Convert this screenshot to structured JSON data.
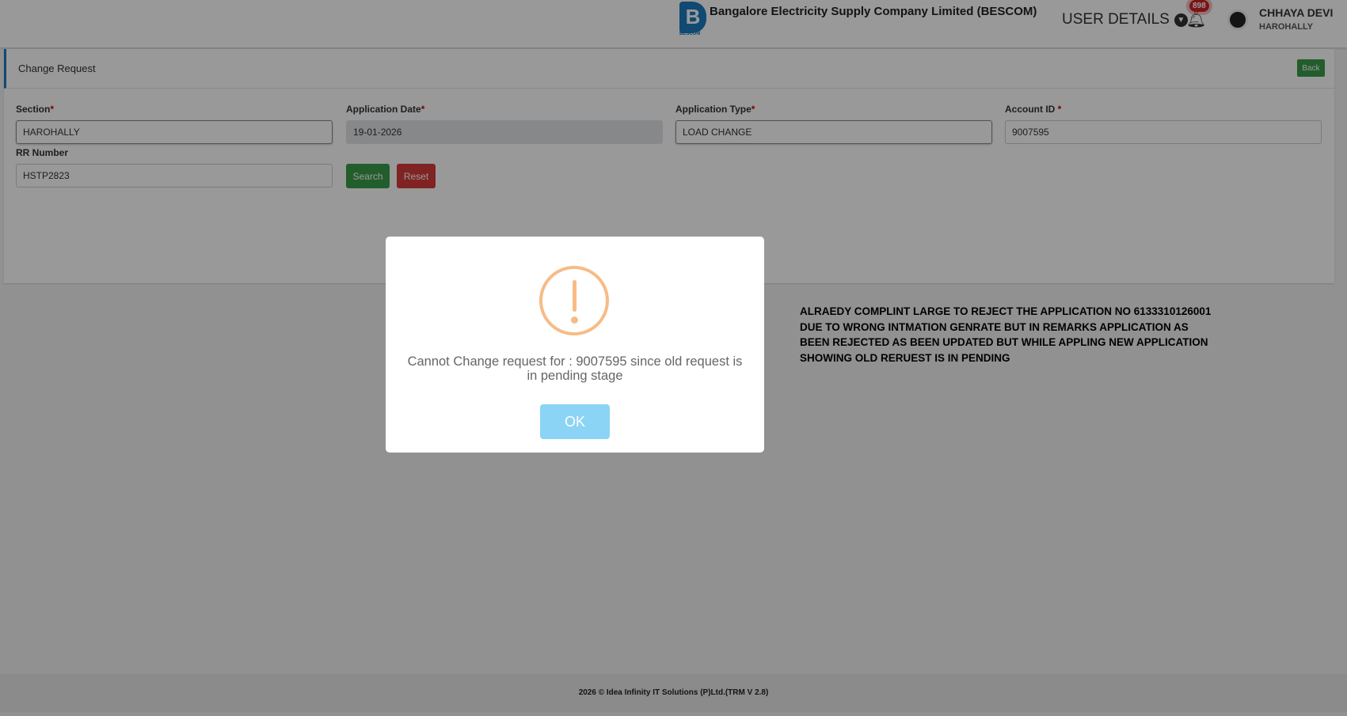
{
  "header": {
    "logo_text": "B",
    "logo_sub": "BESCOM",
    "company": "Bangalore Electricity Supply Company Limited (BESCOM)",
    "user_details": "USER DETAILS",
    "notifications": "898",
    "user_name": "CHHAYA DEVI",
    "user_location": "HAROHALLY"
  },
  "card": {
    "title": "Change Request",
    "back": "Back"
  },
  "form": {
    "section": {
      "label": "Section",
      "value": "HAROHALLY"
    },
    "app_date": {
      "label": "Application Date",
      "value": "19-01-2026"
    },
    "app_type": {
      "label": "Application Type",
      "value": "LOAD CHANGE"
    },
    "account": {
      "label": "Account ID ",
      "value": "9007595"
    },
    "rr": {
      "label": "RR Number",
      "value": "HSTP2823"
    },
    "required": "*",
    "search": "Search",
    "reset": "Reset"
  },
  "remark": "ALRAEDY COMPLINT LARGE TO REJECT THE APPLICATION NO 6133310126001 DUE TO WRONG INTMATION GENRATE BUT IN REMARKS APPLICATION AS BEEN REJECTED AS BEEN UPDATED BUT WHILE APPLING NEW APPLICATION SHOWING OLD RERUEST IS IN PENDING",
  "modal": {
    "message": "Cannot Change request for : 9007595 since old request is in pending stage",
    "ok": "OK"
  },
  "footer": "2026 © Idea Infinity IT Solutions (P)Ltd.(TRM V 2.8)"
}
